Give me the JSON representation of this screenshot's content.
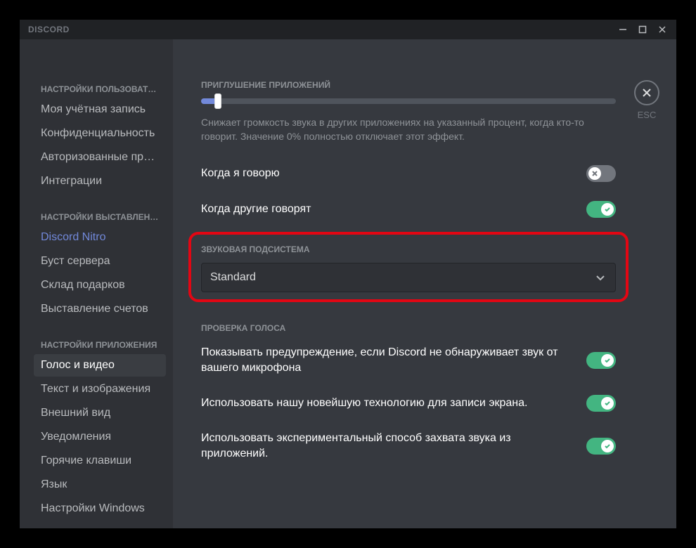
{
  "app_title": "DISCORD",
  "close_esc": "ESC",
  "sidebar": {
    "sections": [
      {
        "header": "НАСТРОЙКИ ПОЛЬЗОВАТЕЛЯ",
        "items": [
          {
            "label": "Моя учётная запись"
          },
          {
            "label": "Конфиденциальность"
          },
          {
            "label": "Авторизованные прил…"
          },
          {
            "label": "Интеграции"
          }
        ]
      },
      {
        "header": "НАСТРОЙКИ ВЫСТАВЛЕНИЯ…",
        "items": [
          {
            "label": "Discord Nitro",
            "accent": true
          },
          {
            "label": "Буст сервера"
          },
          {
            "label": "Склад подарков"
          },
          {
            "label": "Выставление счетов"
          }
        ]
      },
      {
        "header": "НАСТРОЙКИ ПРИЛОЖЕНИЯ",
        "items": [
          {
            "label": "Голос и видео",
            "selected": true
          },
          {
            "label": "Текст и изображения"
          },
          {
            "label": "Внешний вид"
          },
          {
            "label": "Уведомления"
          },
          {
            "label": "Горячие клавиши"
          },
          {
            "label": "Язык"
          },
          {
            "label": "Настройки Windows"
          }
        ]
      }
    ]
  },
  "content": {
    "attenuation": {
      "heading": "ПРИГЛУШЕНИЕ ПРИЛОЖЕНИЙ",
      "slider_percent": 4,
      "help": "Снижает громкость звука в других приложениях на указанный процент, когда кто-то говорит. Значение 0% полностью отключает этот эффект."
    },
    "toggles_top": [
      {
        "label": "Когда я говорю",
        "on": false
      },
      {
        "label": "Когда другие говорят",
        "on": true
      }
    ],
    "audio_subsystem": {
      "heading": "ЗВУКОВАЯ ПОДСИСТЕМА",
      "value": "Standard"
    },
    "voice_check": {
      "heading": "ПРОВЕРКА ГОЛОСА",
      "toggles": [
        {
          "label": "Показывать предупреждение, если Discord не обнаруживает звук от вашего микрофона",
          "on": true
        },
        {
          "label": "Использовать нашу новейшую технологию для записи экрана.",
          "on": true
        },
        {
          "label": "Использовать экспериментальный способ захвата звука из приложений.",
          "on": true
        }
      ]
    }
  }
}
